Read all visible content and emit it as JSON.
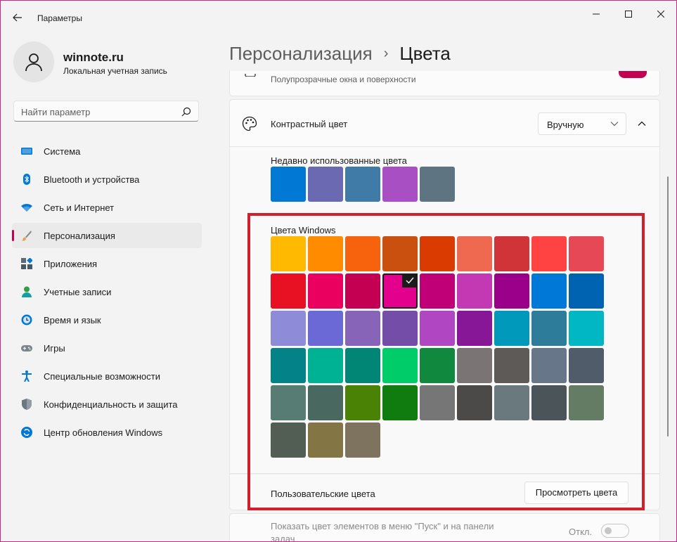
{
  "window": {
    "title": "Параметры"
  },
  "user": {
    "name": "winnote.ru",
    "account": "Локальная учетная запись"
  },
  "search": {
    "placeholder": "Найти параметр"
  },
  "nav": [
    {
      "label": "Система",
      "icon": "monitor-icon",
      "active": false
    },
    {
      "label": "Bluetooth и устройства",
      "icon": "bluetooth-icon",
      "active": false
    },
    {
      "label": "Сеть и Интернет",
      "icon": "wifi-icon",
      "active": false
    },
    {
      "label": "Персонализация",
      "icon": "brush-icon",
      "active": true
    },
    {
      "label": "Приложения",
      "icon": "apps-icon",
      "active": false
    },
    {
      "label": "Учетные записи",
      "icon": "person-icon",
      "active": false
    },
    {
      "label": "Время и язык",
      "icon": "clock-globe-icon",
      "active": false
    },
    {
      "label": "Игры",
      "icon": "gamepad-icon",
      "active": false
    },
    {
      "label": "Специальные возможности",
      "icon": "accessibility-icon",
      "active": false
    },
    {
      "label": "Конфиденциальность и защита",
      "icon": "shield-icon",
      "active": false
    },
    {
      "label": "Центр обновления Windows",
      "icon": "update-icon",
      "active": false
    }
  ],
  "breadcrumb": {
    "parent": "Персонализация",
    "separator": "›",
    "current": "Цвета"
  },
  "transparency": {
    "description": "Полупрозрачные окна и поверхности"
  },
  "accent": {
    "label": "Контрастный цвет",
    "mode": "Вручную",
    "recent_title": "Недавно использованные цвета",
    "recent_colors": [
      "#0078d4",
      "#6b69b1",
      "#3f7ba6",
      "#a84fc4",
      "#5f7481"
    ],
    "windows_title": "Цвета Windows",
    "windows_colors": [
      "#ffb900",
      "#ff8c00",
      "#f7630c",
      "#ca5010",
      "#da3b01",
      "#ef6950",
      "#d13438",
      "#ff4343",
      "#e74856",
      "#e81123",
      "#ea005e",
      "#c30052",
      "#e3008c",
      "#bf0077",
      "#c239b3",
      "#9a0089",
      "#0078d7",
      "#0063b1",
      "#8e8cd8",
      "#6b69d6",
      "#8764b8",
      "#744da9",
      "#b146c2",
      "#881798",
      "#0099bc",
      "#2d7d9a",
      "#00b7c3",
      "#038387",
      "#00b294",
      "#018574",
      "#00cc6a",
      "#10893e",
      "#7a7574",
      "#5d5a58",
      "#68768a",
      "#515c6b",
      "#567c73",
      "#486860",
      "#498205",
      "#107c10",
      "#767676",
      "#4c4a48",
      "#69797e",
      "#4a5459",
      "#647c64",
      "#525e54",
      "#847545",
      "#7e735f"
    ],
    "selected_index": 12
  },
  "custom_colors": {
    "label": "Пользовательские цвета",
    "button": "Просмотреть цвета"
  },
  "start_taskbar": {
    "label": "Показать цвет элементов в меню \"Пуск\" и на панели задач",
    "state": "Откл."
  },
  "colors": {
    "accent": "#c30052",
    "highlight": "#d11f2c",
    "window_border": "#c42b8d"
  }
}
